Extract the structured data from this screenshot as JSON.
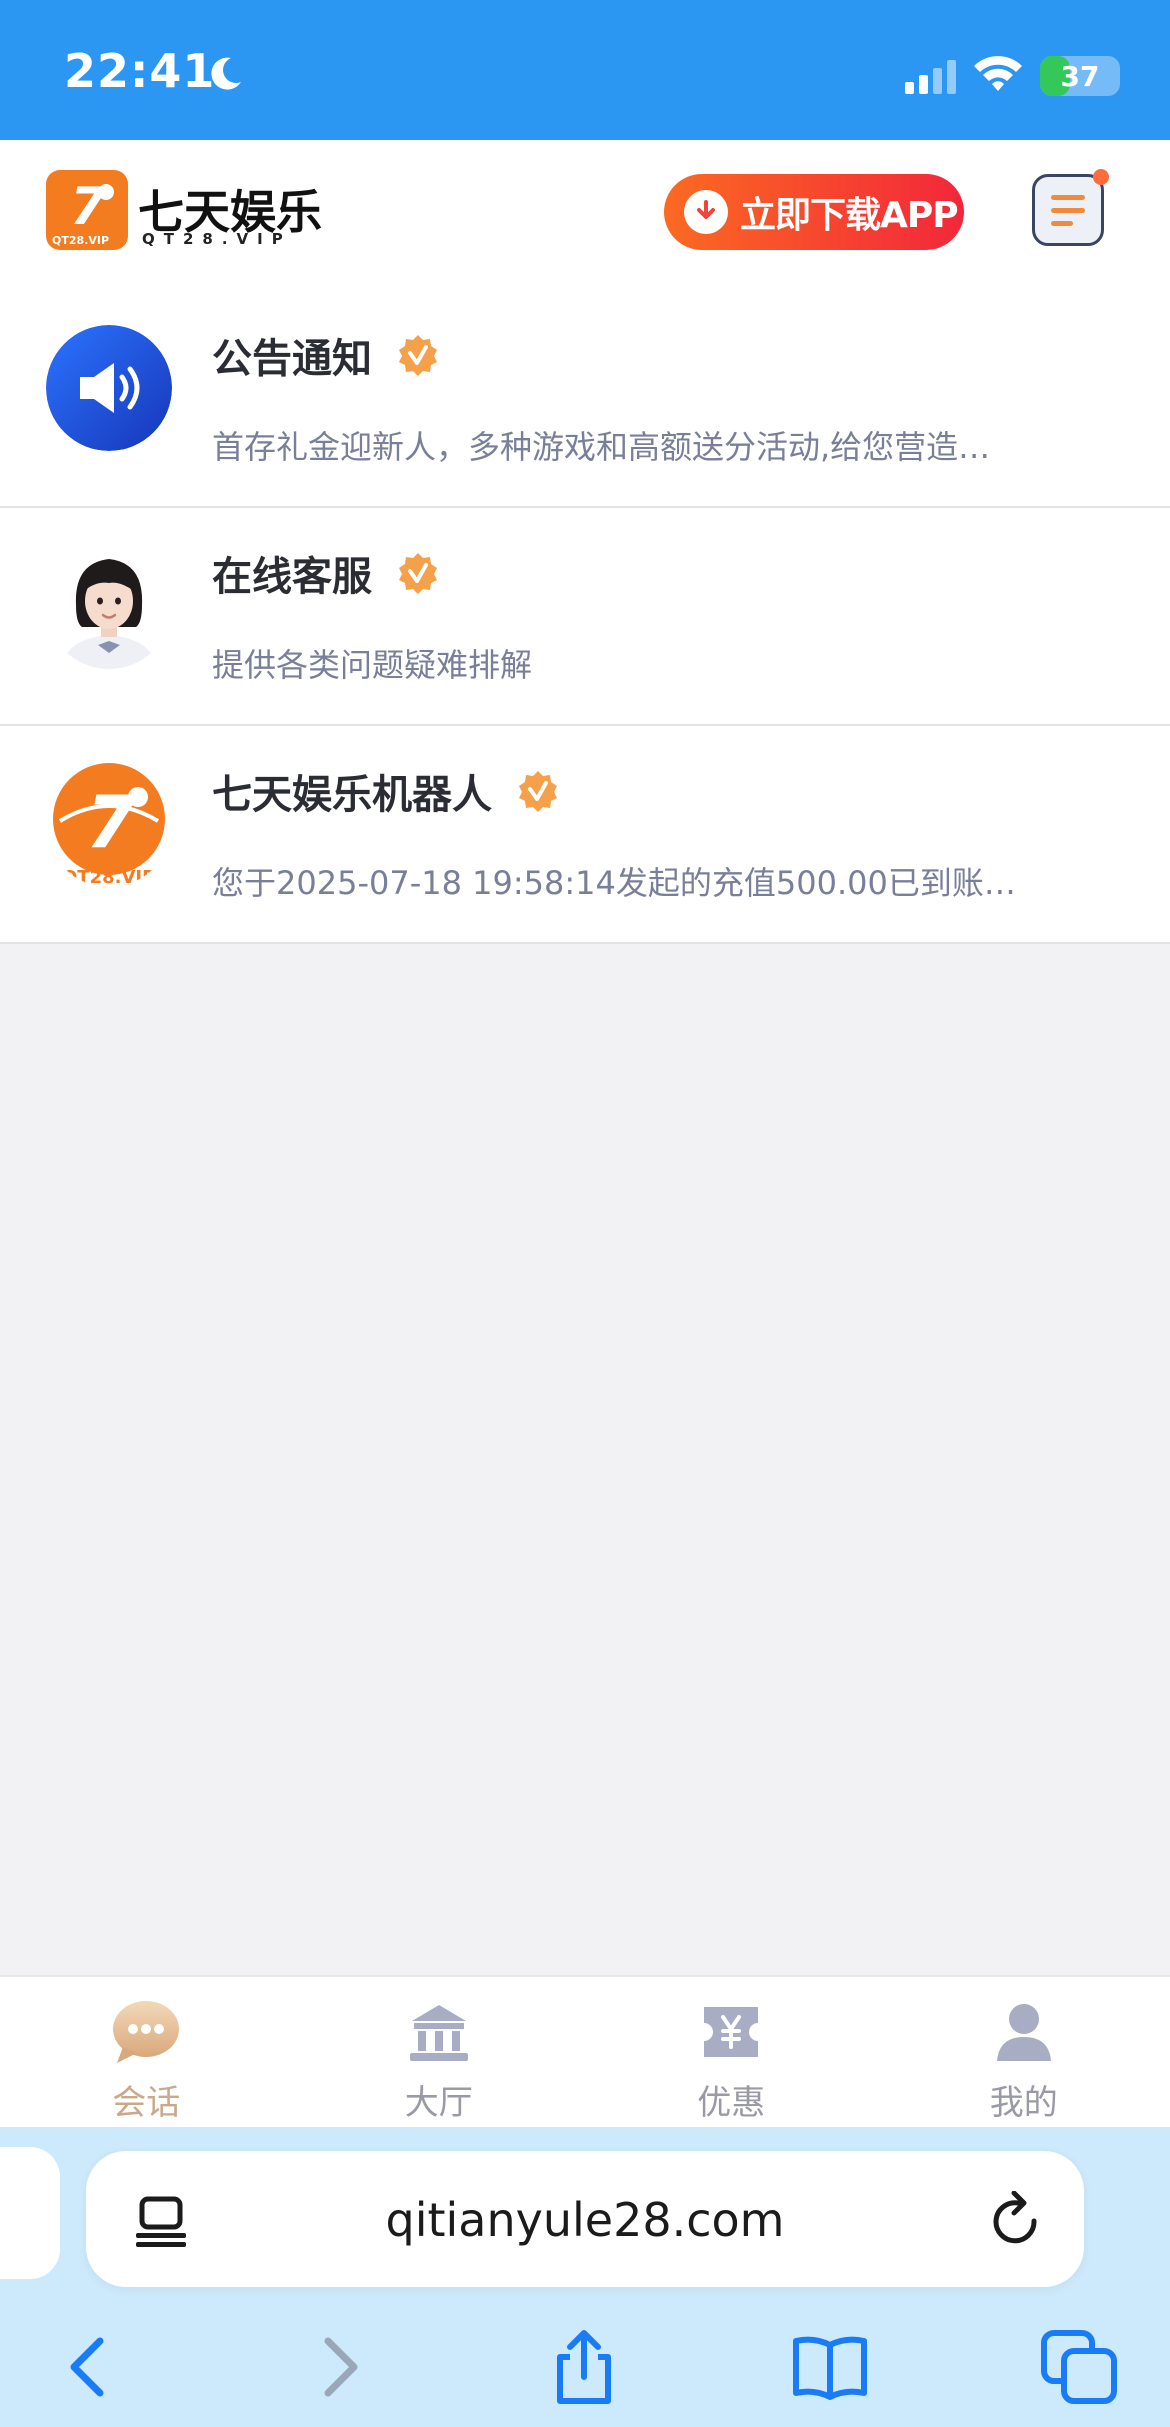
{
  "status_bar": {
    "time": "22:41",
    "battery": "37",
    "battery_level": 0.37
  },
  "header": {
    "logo_title": "七天娱乐",
    "logo_sub": "QT28.VIP",
    "logo_mark_text": "QT28.VIP",
    "download_label": "立即下载APP"
  },
  "conversations": [
    {
      "name": "公告通知",
      "preview": "首存礼金迎新人，多种游戏和高额送分活动,给您营造…",
      "avatar": "megaphone-icon"
    },
    {
      "name": "在线客服",
      "preview": "提供各类问题疑难排解",
      "avatar": "support-agent-avatar"
    },
    {
      "name": "七天娱乐机器人",
      "preview": "您于2025-07-18 19:58:14发起的充值500.00已到账…",
      "avatar": "brand-logo-avatar",
      "avatar_text": "QT28.VIP"
    }
  ],
  "tabs": [
    {
      "label": "会话",
      "icon": "chat-bubble-icon",
      "active": true
    },
    {
      "label": "大厅",
      "icon": "hall-icon",
      "active": false
    },
    {
      "label": "优惠",
      "icon": "coupon-icon",
      "active": false
    },
    {
      "label": "我的",
      "icon": "person-icon",
      "active": false
    }
  ],
  "browser": {
    "url": "qitianyule28.com"
  },
  "colors": {
    "status_bar": "#2b97f3",
    "accent_orange": "#f47c20",
    "download_gradient_end": "#f2273a",
    "active_tab": "#c9a98a"
  }
}
